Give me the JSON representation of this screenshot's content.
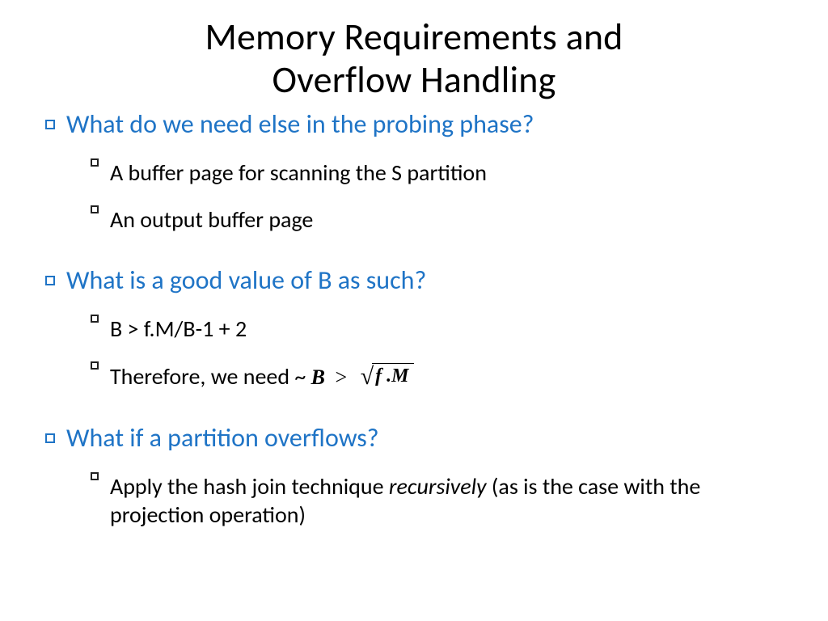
{
  "title_line1": "Memory Requirements and",
  "title_line2": "Overflow Handling",
  "q1": "What do we need else in the probing phase?",
  "q1_a1": "A buffer page for scanning the S partition",
  "q1_a2": "An output buffer page",
  "q2": "What is a good value of B as such?",
  "q2_a1": "B > f.M/B-1 + 2",
  "q2_a2_prefix": "Therefore, we need ~",
  "q2_formula_lhs": "B",
  "q2_formula_gt": ">",
  "q2_formula_sqrt_arg": "f .M",
  "q3": "What if a partition overflows?",
  "q3_a1_prefix": "Apply the hash join technique ",
  "q3_a1_italic": "recursively",
  "q3_a1_suffix": " (as is the case with the projection operation)"
}
